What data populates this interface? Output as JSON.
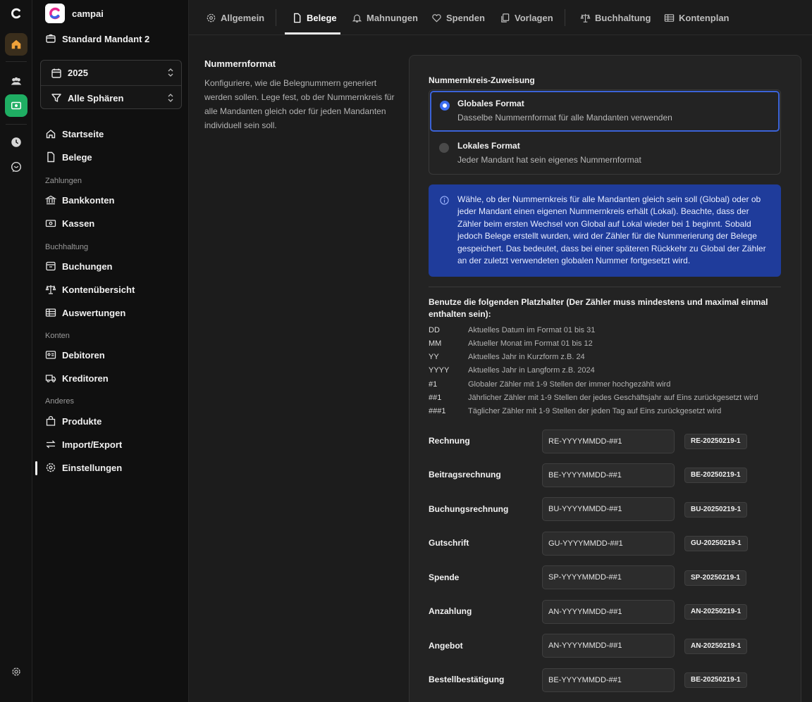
{
  "brand": {
    "name": "campai"
  },
  "mandant": {
    "name": "Standard Mandant 2"
  },
  "picker": {
    "year": "2025",
    "sphere": "Alle Sphären"
  },
  "sidebar": {
    "items": [
      {
        "label": "Startseite"
      },
      {
        "label": "Belege"
      },
      {
        "heading": "Zahlungen"
      },
      {
        "label": "Bankkonten"
      },
      {
        "label": "Kassen"
      },
      {
        "heading": "Buchhaltung"
      },
      {
        "label": "Buchungen"
      },
      {
        "label": "Kontenübersicht"
      },
      {
        "label": "Auswertungen"
      },
      {
        "heading": "Konten"
      },
      {
        "label": "Debitoren"
      },
      {
        "label": "Kreditoren"
      },
      {
        "heading": "Anderes"
      },
      {
        "label": "Produkte"
      },
      {
        "label": "Import/Export"
      },
      {
        "label": "Einstellungen",
        "active": true
      }
    ]
  },
  "tabs": [
    {
      "label": "Allgemein",
      "icon": "gear-icon"
    },
    {
      "label": "Belege",
      "icon": "document-icon",
      "active": true
    },
    {
      "label": "Mahnungen",
      "icon": "bell-icon"
    },
    {
      "label": "Spenden",
      "icon": "heart-icon"
    },
    {
      "label": "Vorlagen",
      "icon": "copy-icon"
    },
    {
      "label": "Buchhaltung",
      "icon": "scale-icon"
    },
    {
      "label": "Kontenplan",
      "icon": "table-icon"
    }
  ],
  "section": {
    "title": "Nummernformat",
    "description": "Konfiguriere, wie die Belegnummern generiert werden sollen. Lege fest, ob der Nummernkreis für alle Mandanten gleich oder für jeden Mandanten individuell sein soll."
  },
  "assignment": {
    "label": "Nummernkreis-Zuweisung",
    "options": [
      {
        "title": "Globales Format",
        "subtitle": "Dasselbe Nummernformat für alle Mandanten verwenden",
        "selected": true
      },
      {
        "title": "Lokales Format",
        "subtitle": "Jeder Mandant hat sein eigenes Nummernformat",
        "selected": false
      }
    ]
  },
  "info": {
    "text": "Wähle, ob der Nummernkreis für alle Mandanten gleich sein soll (Global) oder ob jeder Mandant einen eigenen Nummernkreis erhält (Lokal). Beachte, dass der Zähler beim ersten Wechsel von Global auf Lokal wieder bei 1 beginnt. Sobald jedoch Belege erstellt wurden, wird der Zähler für die Nummerierung der Belege gespeichert. Das bedeutet, dass bei einer späteren Rückkehr zu Global der Zähler an der zuletzt verwendeten globalen Nummer fortgesetzt wird."
  },
  "placeholders": {
    "heading": "Benutze die folgenden Platzhalter (Der Zähler muss mindestens und maximal einmal enthalten sein):",
    "rows": [
      {
        "key": "DD",
        "desc": "Aktuelles Datum im Format 01 bis 31"
      },
      {
        "key": "MM",
        "desc": "Aktueller Monat im Format 01 bis 12"
      },
      {
        "key": "YY",
        "desc": "Aktuelles Jahr in Kurzform z.B. 24"
      },
      {
        "key": "YYYY",
        "desc": "Aktuelles Jahr in Langform z.B. 2024"
      },
      {
        "key": "#1",
        "desc": "Globaler Zähler mit 1-9 Stellen der immer hochgezählt wird"
      },
      {
        "key": "##1",
        "desc": "Jährlicher Zähler mit 1-9 Stellen der jedes Geschäftsjahr auf Eins zurückgesetzt wird"
      },
      {
        "key": "###1",
        "desc": "Täglicher Zähler mit 1-9 Stellen der jeden Tag auf Eins zurückgesetzt wird"
      }
    ]
  },
  "formats": [
    {
      "label": "Rechnung",
      "value": "RE-YYYYMMDD-##1",
      "preview": "RE-20250219-1"
    },
    {
      "label": "Beitragsrechnung",
      "value": "BE-YYYYMMDD-##1",
      "preview": "BE-20250219-1"
    },
    {
      "label": "Buchungsrechnung",
      "value": "BU-YYYYMMDD-##1",
      "preview": "BU-20250219-1"
    },
    {
      "label": "Gutschrift",
      "value": "GU-YYYYMMDD-##1",
      "preview": "GU-20250219-1"
    },
    {
      "label": "Spende",
      "value": "SP-YYYYMMDD-##1",
      "preview": "SP-20250219-1"
    },
    {
      "label": "Anzahlung",
      "value": "AN-YYYYMMDD-##1",
      "preview": "AN-20250219-1"
    },
    {
      "label": "Angebot",
      "value": "AN-YYYYMMDD-##1",
      "preview": "AN-20250219-1"
    },
    {
      "label": "Bestellbestätigung",
      "value": "BE-YYYYMMDD-##1",
      "preview": "BE-20250219-1"
    }
  ],
  "colors": {
    "accent": "#3d6ef0",
    "info_bg": "#1f3c9b",
    "home_active": "#f0a23a",
    "green_app": "#1fae63"
  }
}
